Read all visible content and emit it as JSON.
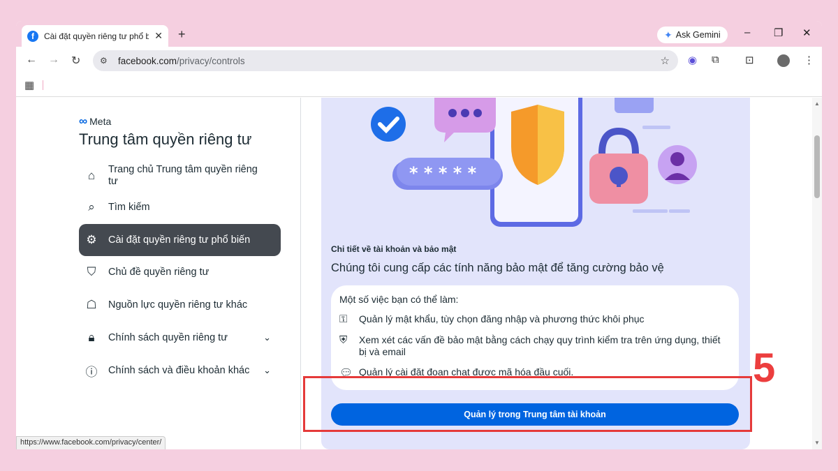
{
  "browser": {
    "tab_title": "Cài đặt quyền riêng tư phổ biến",
    "tab_favicon": "f",
    "tab_close": "✕",
    "new_tab": "+",
    "gemini_label": "Ask Gemini",
    "url_domain": "facebook.com",
    "url_path": "/privacy/controls",
    "status_url": "https://www.facebook.com/privacy/center/"
  },
  "sidebar": {
    "brand": "Meta",
    "title": "Trung tâm quyền riêng tư",
    "items": [
      {
        "label": "Trang chủ Trung tâm quyền riêng tư",
        "icon": "home-icon",
        "glyph": "⌂",
        "active": false,
        "expandable": false
      },
      {
        "label": "Tìm kiếm",
        "icon": "search-icon",
        "glyph": "⌕",
        "active": false,
        "expandable": false
      },
      {
        "label": "Cài đặt quyền riêng tư phổ biến",
        "icon": "gear-icon",
        "glyph": "⚙",
        "active": true,
        "expandable": false
      },
      {
        "label": "Chủ đề quyền riêng tư",
        "icon": "shield-icon",
        "glyph": "⛉",
        "active": false,
        "expandable": false
      },
      {
        "label": "Nguồn lực quyền riêng tư khác",
        "icon": "incognito-icon",
        "glyph": "☖",
        "active": false,
        "expandable": false
      },
      {
        "label": "Chính sách quyền riêng tư",
        "icon": "lock-icon",
        "glyph": "🔒︎",
        "active": false,
        "expandable": true
      },
      {
        "label": "Chính sách và điều khoản khác",
        "icon": "info-icon",
        "glyph": "ⓘ",
        "active": false,
        "expandable": true
      }
    ]
  },
  "card": {
    "kicker": "Chi tiết về tài khoản và bảo mật",
    "heading": "Chúng tôi cung cấp các tính năng bảo mật để tăng cường bảo vệ",
    "list_title": "Một số việc bạn có thể làm:",
    "features": [
      {
        "icon": "key-icon",
        "glyph": "⚿",
        "text": "Quản lý mật khẩu, tùy chọn đăng nhập và phương thức khôi phục"
      },
      {
        "icon": "shield-check-icon",
        "glyph": "⛨",
        "text": "Xem xét các vấn đề bảo mật bằng cách chạy quy trình kiểm tra trên ứng dụng, thiết bị và email"
      },
      {
        "icon": "chat-lock-icon",
        "glyph": "💬︎",
        "text": "Quản lý cài đặt đoạn chat được mã hóa đầu cuối."
      }
    ],
    "password_mask": "* * * * *",
    "cta_label": "Quản lý trong Trung tâm tài khoản"
  },
  "annotation": {
    "step_number": "5",
    "color": "#e53a3a"
  },
  "colors": {
    "accent": "#0064e0",
    "active_nav": "#444950",
    "card_bg": "#e2e4fb",
    "page_bg": "#f5cfe0"
  }
}
